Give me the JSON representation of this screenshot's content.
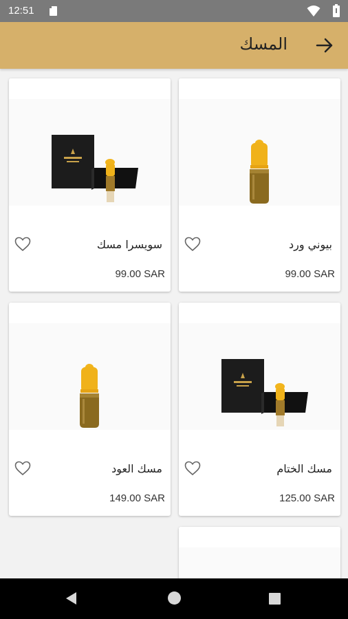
{
  "status": {
    "time": "12:51"
  },
  "header": {
    "title": "المسك"
  },
  "products": [
    {
      "name": "بيوني ورد",
      "price": "99.00 SAR",
      "image": "bottle"
    },
    {
      "name": "سويسرا مسك",
      "price": "99.00 SAR",
      "image": "box-bottle"
    },
    {
      "name": "مسك الختام",
      "price": "125.00 SAR",
      "image": "box-bottle"
    },
    {
      "name": "مسك العود",
      "price": "149.00 SAR",
      "image": "bottle"
    }
  ],
  "colors": {
    "app_bar": "#d6b06a",
    "status_bar": "#7a7a7a",
    "cap_gold": "#f0b21a",
    "oil_amber": "#8a6a1f"
  }
}
